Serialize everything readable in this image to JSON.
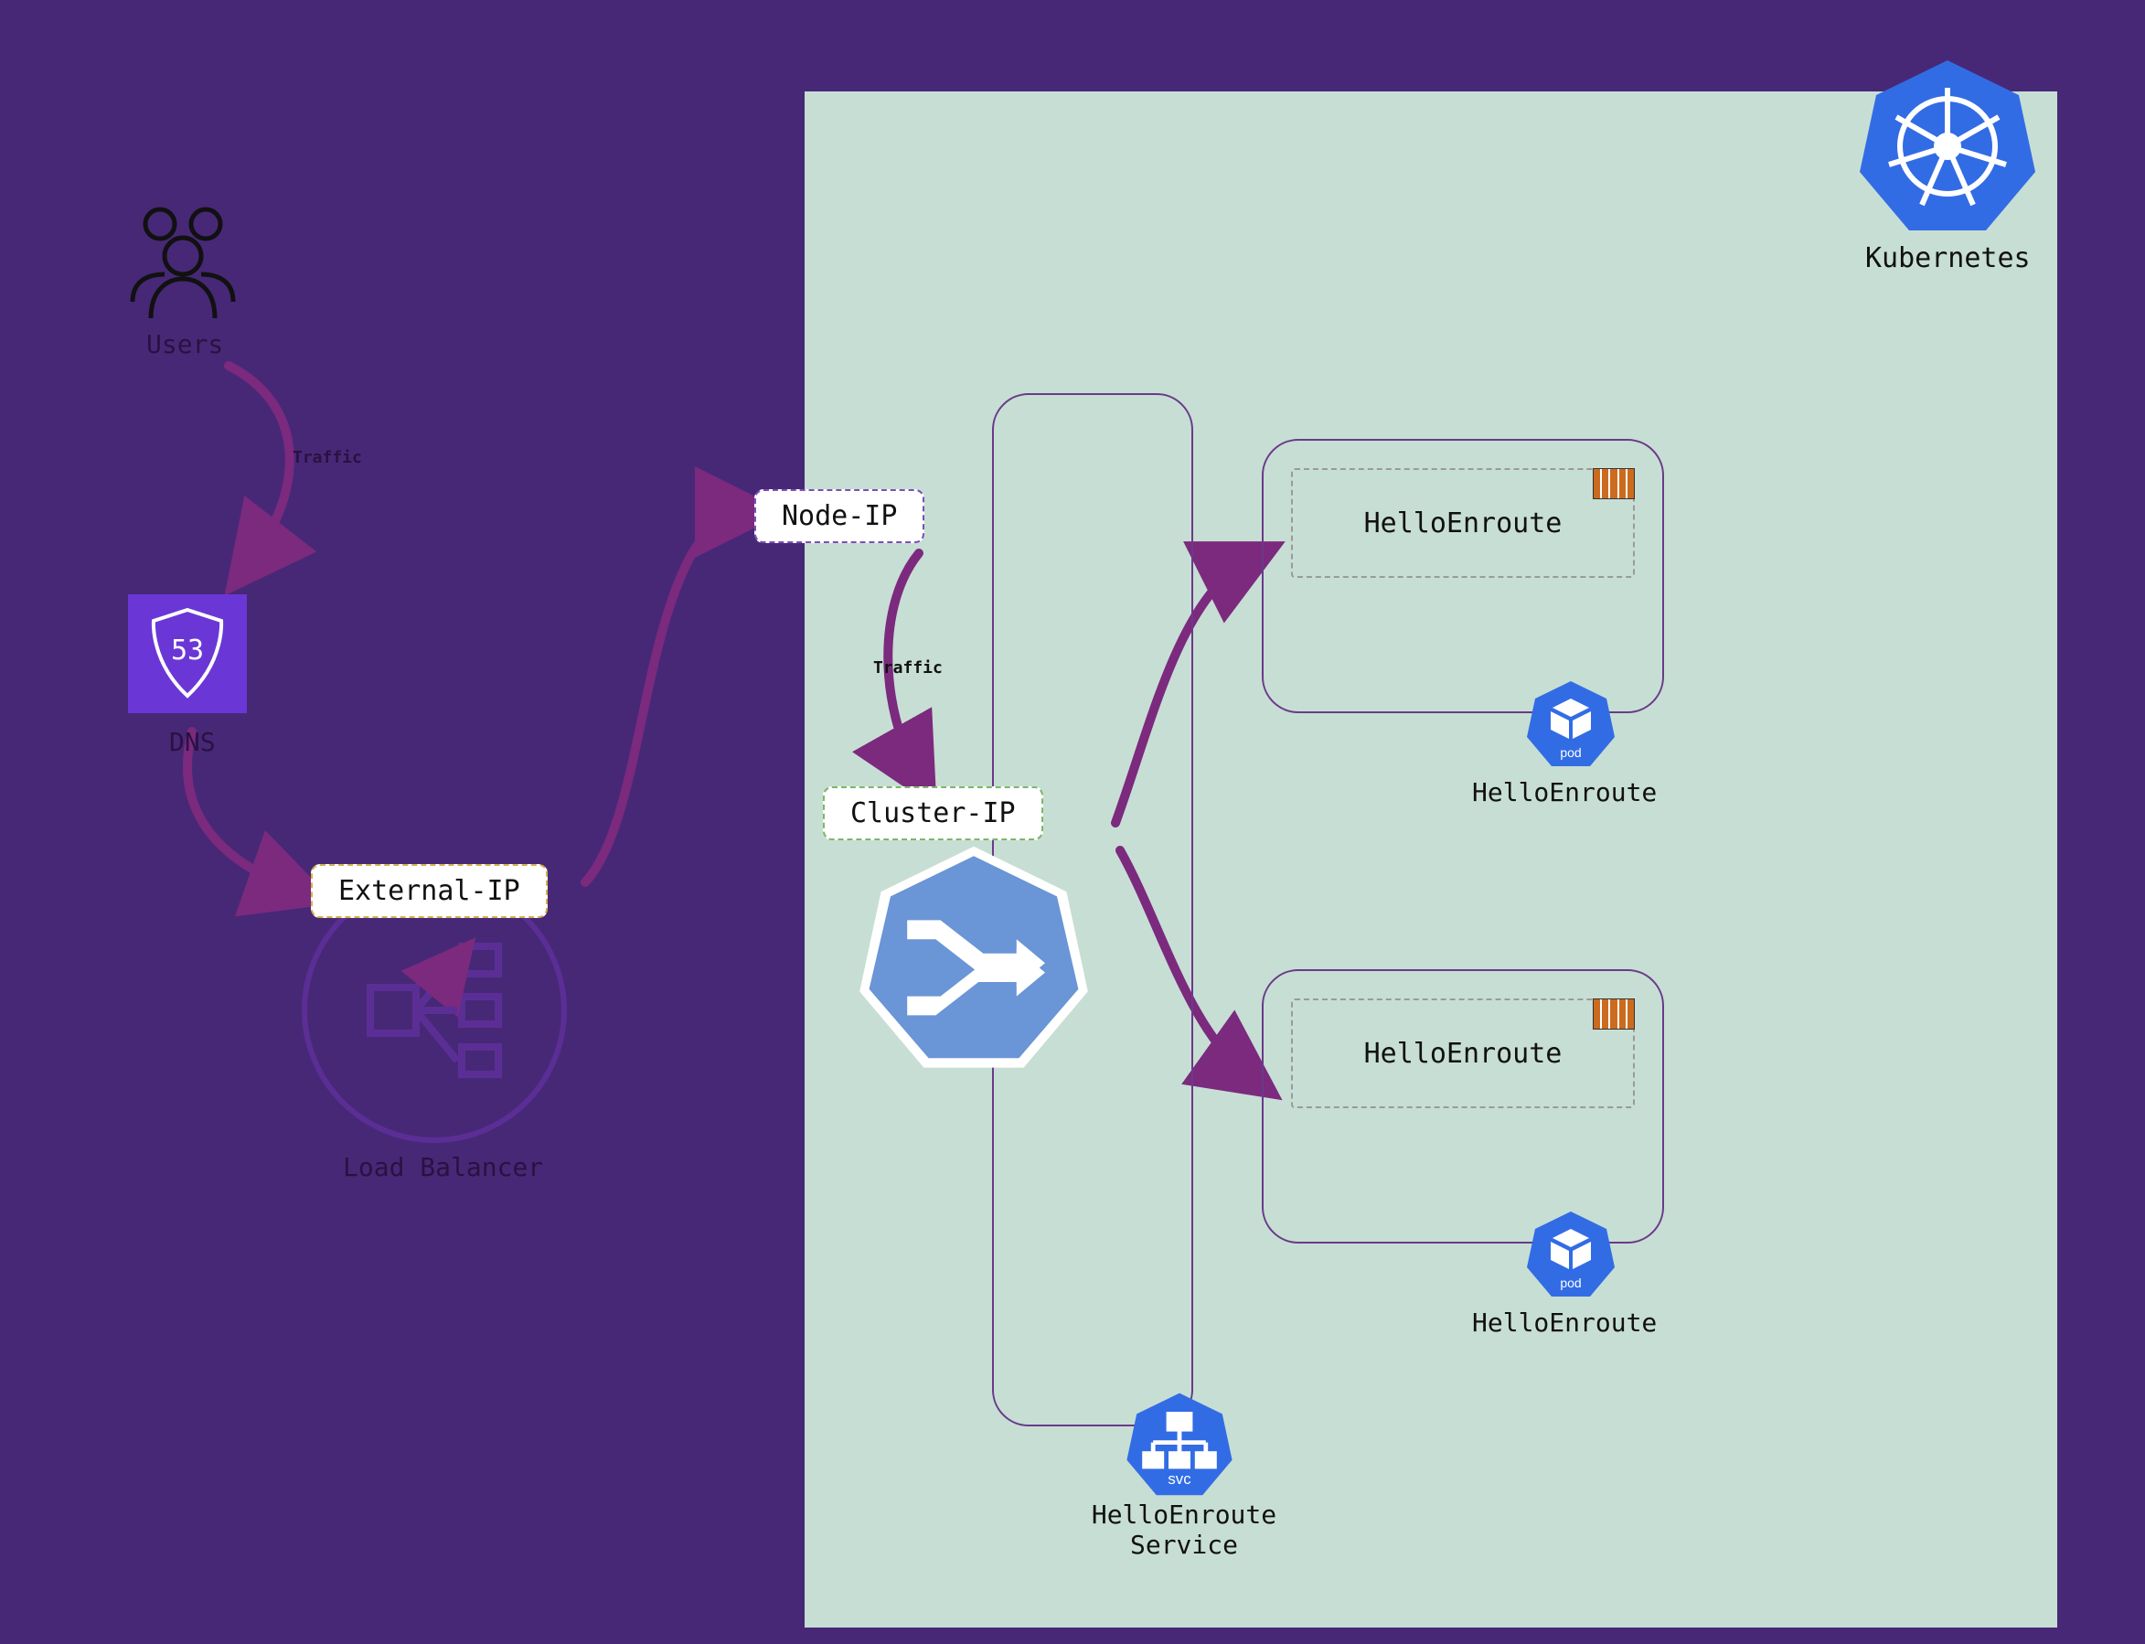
{
  "labels": {
    "users": "Users",
    "traffic1": "Traffic",
    "dns": "DNS",
    "external_ip": "External-IP",
    "load_balancer": "Load Balancer",
    "node_ip": "Node-IP",
    "traffic2": "Traffic",
    "cluster_ip": "Cluster-IP",
    "kubernetes": "Kubernetes",
    "svc_name": "HelloEnroute\nService",
    "pod1_name": "HelloEnroute",
    "pod1_inner": "HelloEnroute",
    "pod2_name": "HelloEnroute",
    "pod2_inner": "HelloEnroute"
  },
  "colors": {
    "bg": "#472877",
    "panel": "#c7ded4",
    "arrow": "#7b2a7e",
    "k8s_blue": "#326ce5",
    "hept_blue": "#6a95d6"
  }
}
